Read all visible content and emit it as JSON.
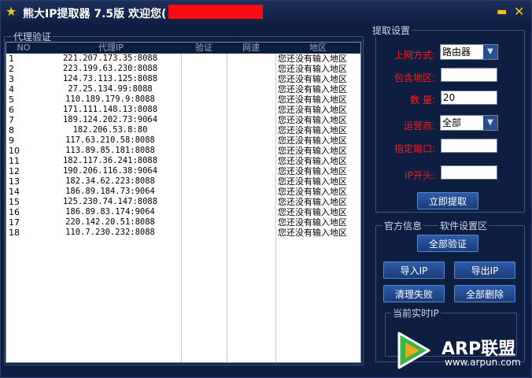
{
  "title": "熊大IP提取器 7.5版 欢迎您(",
  "title_bar": {
    "minimize_icon": "minimize-icon",
    "close_icon": "close-icon"
  },
  "left_panel": {
    "group_title": "代理验证",
    "columns": [
      "NO",
      "代理IP",
      "验证",
      "网速",
      "地区"
    ],
    "rows": [
      {
        "no": "1",
        "ip": "221.207.173.35:8088",
        "region": "您还没有输入地区"
      },
      {
        "no": "2",
        "ip": "223.199.63.230:8088",
        "region": "您还没有输入地区"
      },
      {
        "no": "3",
        "ip": "124.73.113.125:8088",
        "region": "您还没有输入地区"
      },
      {
        "no": "4",
        "ip": "27.25.134.99:8088",
        "region": "您还没有输入地区"
      },
      {
        "no": "5",
        "ip": "110.189.179.9:8088",
        "region": "您还没有输入地区"
      },
      {
        "no": "6",
        "ip": "171.111.148.13:8088",
        "region": "您还没有输入地区"
      },
      {
        "no": "7",
        "ip": "189.124.202.73:9064",
        "region": "您还没有输入地区"
      },
      {
        "no": "8",
        "ip": "182.206.53.8:80",
        "region": "您还没有输入地区"
      },
      {
        "no": "9",
        "ip": "117.63.210.58:8088",
        "region": "您还没有输入地区"
      },
      {
        "no": "10",
        "ip": "113.89.85.181:8088",
        "region": "您还没有输入地区"
      },
      {
        "no": "11",
        "ip": "182.117.36.241:8088",
        "region": "您还没有输入地区"
      },
      {
        "no": "12",
        "ip": "190.206.116.38:9064",
        "region": "您还没有输入地区"
      },
      {
        "no": "13",
        "ip": "182.34.62.223:8088",
        "region": "您还没有输入地区"
      },
      {
        "no": "14",
        "ip": "186.89.184.73:9064",
        "region": "您还没有输入地区"
      },
      {
        "no": "15",
        "ip": "125.230.74.147:8088",
        "region": "您还没有输入地区"
      },
      {
        "no": "16",
        "ip": "186.89.83.174:9064",
        "region": "您还没有输入地区"
      },
      {
        "no": "17",
        "ip": "220.142.20.51:8088",
        "region": "您还没有输入地区"
      },
      {
        "no": "18",
        "ip": "110.7.230.232:8088",
        "region": "您还没有输入地区"
      }
    ]
  },
  "settings": {
    "group_title": "提取设置",
    "network_label": "上网方式:",
    "network_value": "路由器",
    "region_label": "包含地区:",
    "region_value": "",
    "count_label": "数  量:",
    "count_value": "20",
    "carrier_label": "运营商:",
    "carrier_value": "全部",
    "port_label": "指定端口:",
    "port_value": "",
    "ip_prefix_label": "IP开头:",
    "ip_prefix_value": "",
    "extract_button": "立即提取"
  },
  "software": {
    "official_label": "官方信息",
    "settings_label": "软件设置区",
    "verify_all_button": "全部验证",
    "import_button": "导入IP",
    "export_button": "导出IP",
    "clean_fail_button": "清理失败",
    "delete_all_button": "全部删除",
    "current_ip_title": "当前实时IP"
  },
  "watermark": {
    "brand": "ARP联盟",
    "url": "www.arpun.com"
  },
  "colors": {
    "background": "#0e1e40",
    "label_red": "#ff1a1a",
    "button_blue": "#2e5ba8",
    "title_star": "#f6c21a",
    "redaction": "#ff0a12"
  }
}
